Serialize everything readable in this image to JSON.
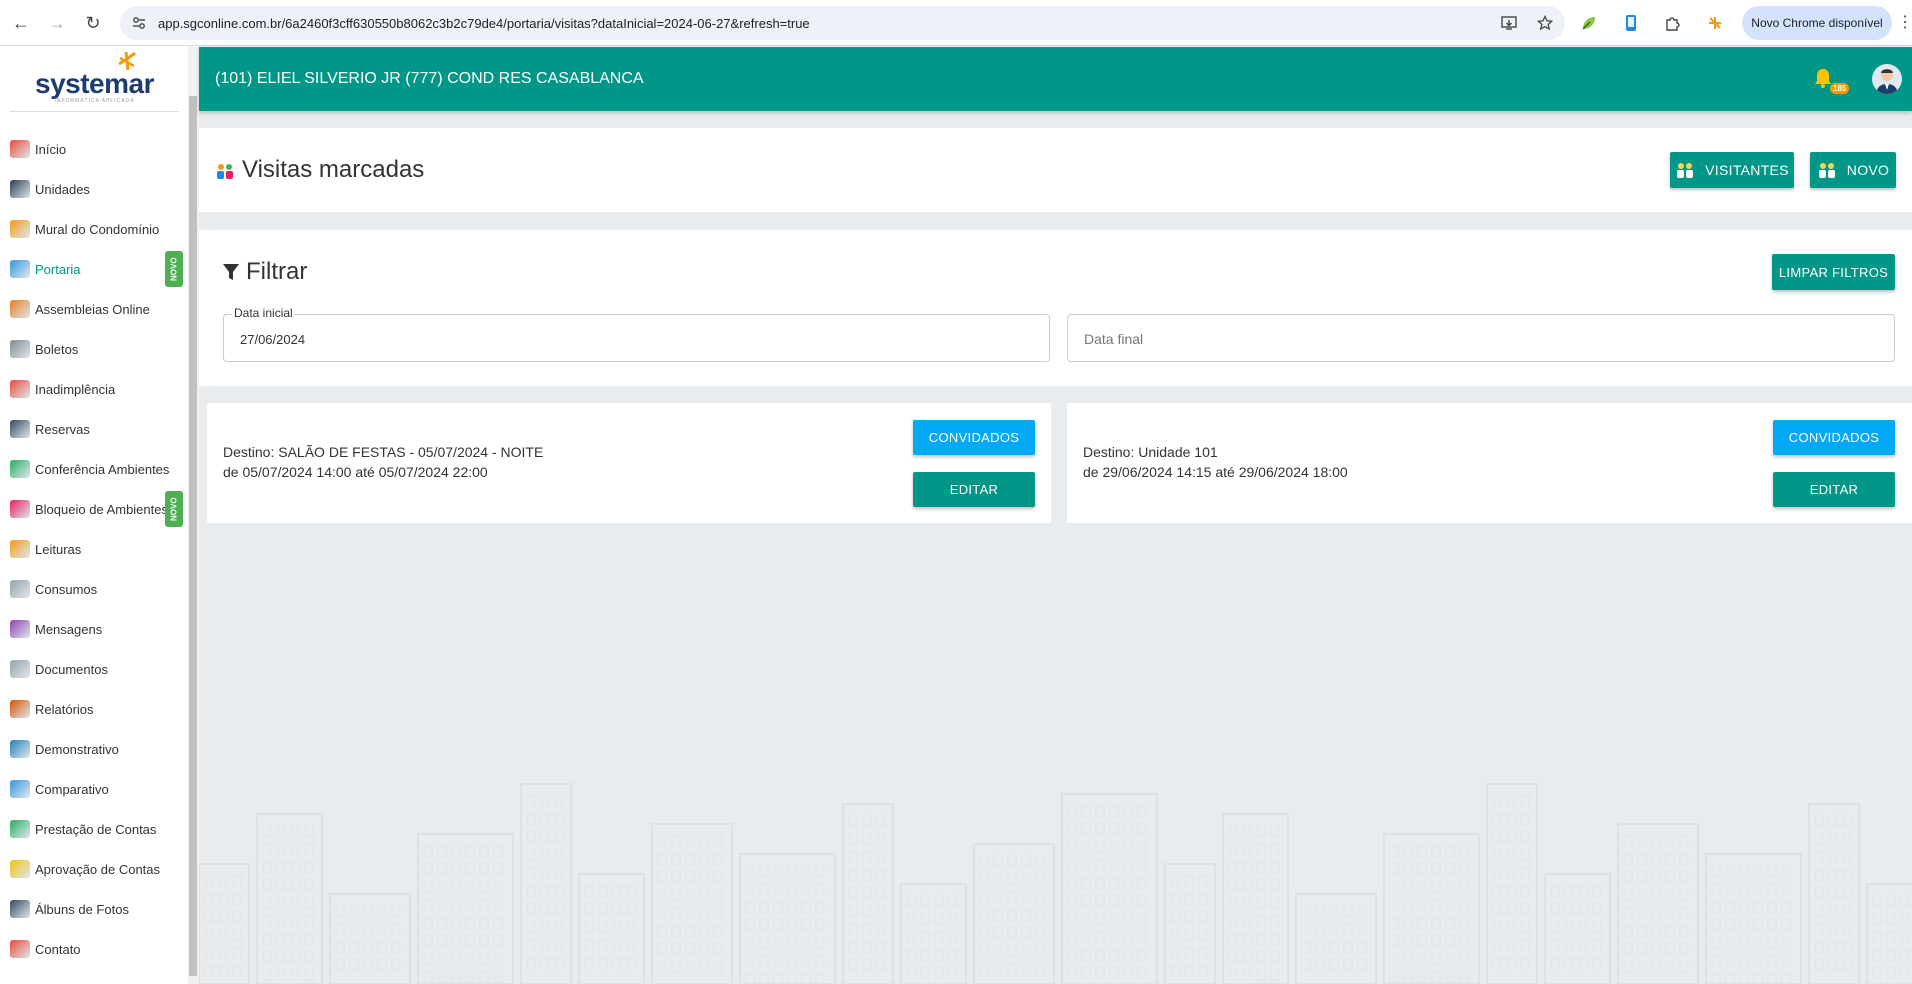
{
  "browser": {
    "url": "app.sgconline.com.br/6a2460f3cff630550b8062c3b2c79de4/portaria/visitas?dataInicial=2024-06-27&refresh=true",
    "chrome_update_label": "Novo Chrome disponível"
  },
  "logo": {
    "name": "systemar",
    "tagline": "INFORMÁTICA APLICADA"
  },
  "sidebar": {
    "items": [
      {
        "label": "Início",
        "icon": "home-icon"
      },
      {
        "label": "Unidades",
        "icon": "person-icon"
      },
      {
        "label": "Mural do Condomínio",
        "icon": "board-icon"
      },
      {
        "label": "Portaria",
        "icon": "gate-icon",
        "badge": "NOVO"
      },
      {
        "label": "Assembleias Online",
        "icon": "meeting-icon"
      },
      {
        "label": "Boletos",
        "icon": "barcode-icon"
      },
      {
        "label": "Inadimplência",
        "icon": "debt-icon"
      },
      {
        "label": "Reservas",
        "icon": "calendar-icon"
      },
      {
        "label": "Conferência Ambientes",
        "icon": "check-calendar-icon"
      },
      {
        "label": "Bloqueio de Ambientes",
        "icon": "block-icon",
        "badge": "NOVO"
      },
      {
        "label": "Leituras",
        "icon": "reading-icon"
      },
      {
        "label": "Consumos",
        "icon": "consumption-icon"
      },
      {
        "label": "Mensagens",
        "icon": "messages-icon"
      },
      {
        "label": "Documentos",
        "icon": "documents-icon"
      },
      {
        "label": "Relatórios",
        "icon": "report-icon"
      },
      {
        "label": "Demonstrativo",
        "icon": "chart-icon"
      },
      {
        "label": "Comparativo",
        "icon": "pie-icon"
      },
      {
        "label": "Prestação de Contas",
        "icon": "accounts-icon"
      },
      {
        "label": "Aprovação de Contas",
        "icon": "approval-icon"
      },
      {
        "label": "Álbuns de Fotos",
        "icon": "photo-icon"
      },
      {
        "label": "Contato",
        "icon": "phone-icon"
      }
    ],
    "active_index": 3
  },
  "topbar": {
    "title": "(101) ELIEL SILVERIO JR  (777) COND RES CASABLANCA",
    "notification_count": "185"
  },
  "page": {
    "title": "Visitas marcadas",
    "visitantes_label": "VISITANTES",
    "novo_label": "NOVO"
  },
  "filter": {
    "title": "Filtrar",
    "clear_label": "LIMPAR FILTROS",
    "start_label": "Data inicial",
    "start_value": "27/06/2024",
    "end_placeholder": "Data final"
  },
  "visits": [
    {
      "destino": "Destino: SALÃO DE FESTAS - 05/07/2024 - NOITE",
      "periodo": "de 05/07/2024 14:00 até 05/07/2024 22:00",
      "convidados_label": "CONVIDADOS",
      "editar_label": "EDITAR"
    },
    {
      "destino": "Destino: Unidade 101",
      "periodo": "de 29/06/2024 14:15 até 29/06/2024 18:00",
      "convidados_label": "CONVIDADOS",
      "editar_label": "EDITAR"
    }
  ],
  "colors": {
    "primary": "#009688",
    "accent_blue": "#03a9f4",
    "badge_green": "#4caf50"
  }
}
